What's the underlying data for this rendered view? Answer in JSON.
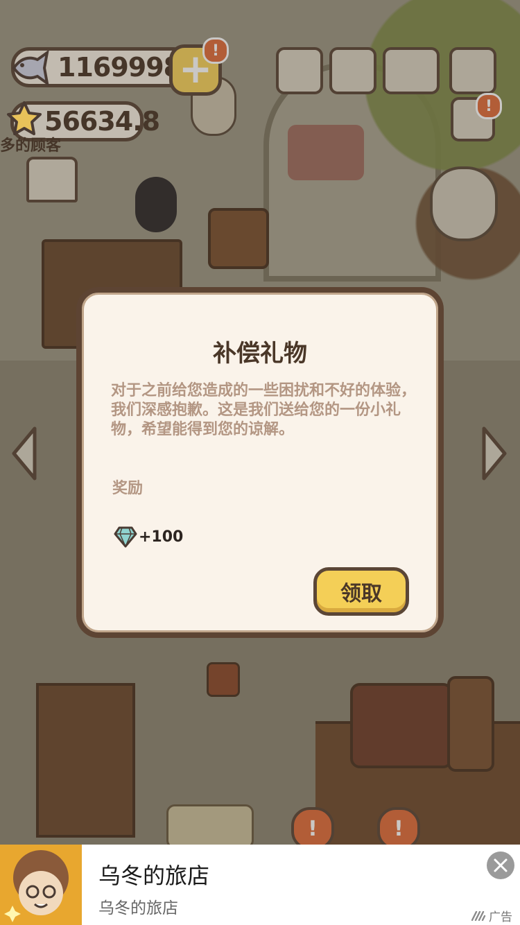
{
  "hud": {
    "fish_count": "11699983",
    "star_count": "56634.8",
    "ticker_text": "多的顾客",
    "alert_mark": "!"
  },
  "dialog": {
    "title": "补偿礼物",
    "body": "对于之前给您造成的一些困扰和不好的体验，我们深感抱歉。这是我们送给您的一份小礼物，希望能得到您的谅解。",
    "reward_label": "奖励",
    "reward_amount": "+100",
    "reward_icon": "diamond-icon",
    "claim_label": "领取"
  },
  "ad": {
    "title": "乌冬的旅店",
    "subtitle": "乌冬的旅店",
    "label": "广告"
  },
  "colors": {
    "dialog_bg": "#faf3ea",
    "dialog_border": "#5d4433",
    "button_yellow": "#f4cf57",
    "alert_orange": "#e06c3b",
    "body_text": "#b39683"
  }
}
